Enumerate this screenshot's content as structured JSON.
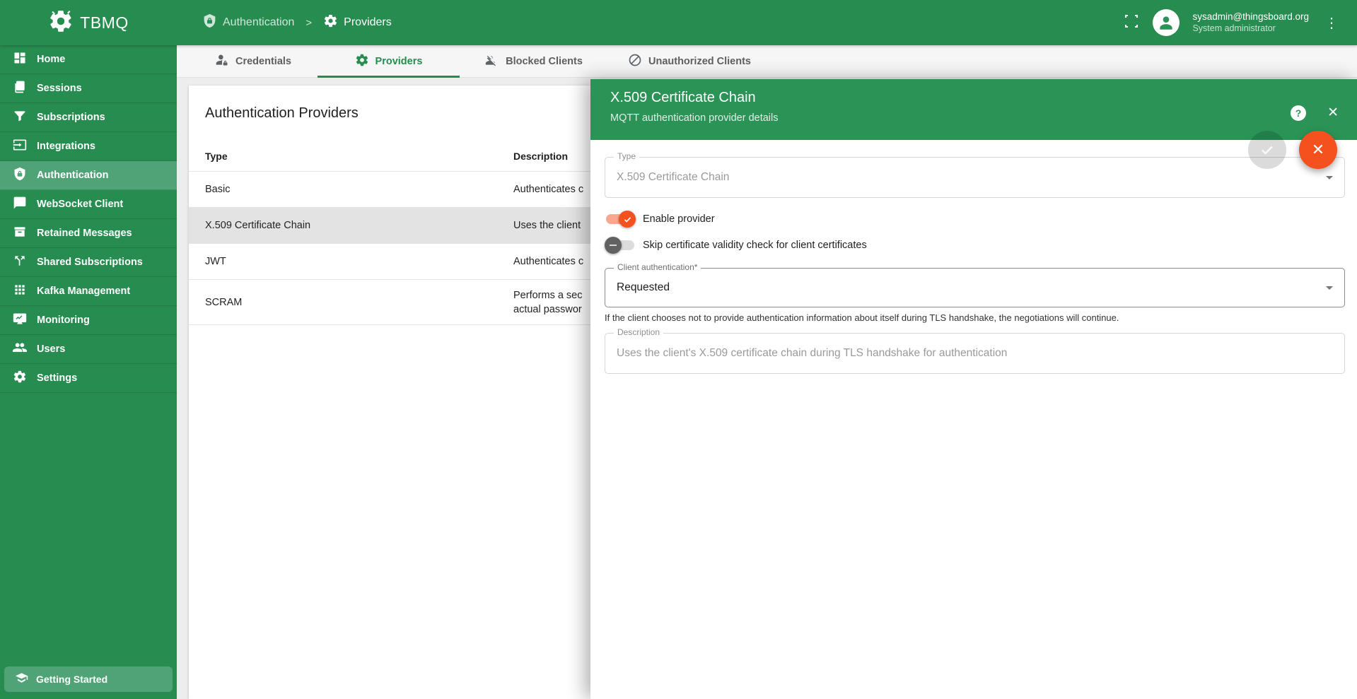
{
  "colors": {
    "primary_green": "#268C4F",
    "active_green": "#4FA376",
    "panel_green": "#2B9356",
    "deep_orange": "#F4511E",
    "selected_row": "#E3E3E3",
    "page_bg": "#EDEDED"
  },
  "icons": {
    "help": "?",
    "close": "✕",
    "more": "⋮",
    "crumb_separator": ">"
  },
  "topbar": {
    "brand": "TBMQ",
    "breadcrumb": {
      "parent": "Authentication",
      "current": "Providers"
    },
    "user": {
      "email": "sysadmin@thingsboard.org",
      "role": "System administrator"
    }
  },
  "sidebar": {
    "items": [
      {
        "label": "Home",
        "icon": "dashboard-icon"
      },
      {
        "label": "Sessions",
        "icon": "sessions-icon"
      },
      {
        "label": "Subscriptions",
        "icon": "filter-icon"
      },
      {
        "label": "Integrations",
        "icon": "integrations-icon"
      },
      {
        "label": "Authentication",
        "icon": "shield-lock-icon",
        "active": true
      },
      {
        "label": "WebSocket Client",
        "icon": "chat-icon"
      },
      {
        "label": "Retained Messages",
        "icon": "archive-icon"
      },
      {
        "label": "Shared Subscriptions",
        "icon": "split-icon"
      },
      {
        "label": "Kafka Management",
        "icon": "grid-icon"
      },
      {
        "label": "Monitoring",
        "icon": "monitor-icon"
      },
      {
        "label": "Users",
        "icon": "users-icon"
      },
      {
        "label": "Settings",
        "icon": "gear-icon"
      }
    ],
    "getting_started": "Getting Started"
  },
  "tabs": [
    {
      "label": "Credentials",
      "icon": "person-lock-icon"
    },
    {
      "label": "Providers",
      "icon": "gear-icon",
      "active": true
    },
    {
      "label": "Blocked Clients",
      "icon": "person-off-icon"
    },
    {
      "label": "Unauthorized Clients",
      "icon": "block-icon"
    }
  ],
  "main": {
    "title": "Authentication Providers",
    "table": {
      "col_type": "Type",
      "col_description": "Description",
      "rows": [
        {
          "type": "Basic",
          "desc": "Authenticates c"
        },
        {
          "type": "X.509 Certificate Chain",
          "desc": "Uses the client",
          "selected": true
        },
        {
          "type": "JWT",
          "desc": "Authenticates c"
        },
        {
          "type": "SCRAM",
          "desc": "Performs a sec",
          "desc2": "actual passwor"
        }
      ]
    }
  },
  "panel": {
    "title": "X.509 Certificate Chain",
    "subtitle": "MQTT authentication provider details",
    "type_field": {
      "label": "Type",
      "value": "X.509 Certificate Chain"
    },
    "enable_toggle": {
      "label": "Enable provider",
      "on": true
    },
    "skip_toggle": {
      "label": "Skip certificate validity check for client certificates",
      "on": false
    },
    "client_auth_field": {
      "label": "Client authentication*",
      "value": "Requested",
      "hint": "If the client chooses not to provide authentication information about itself during TLS handshake, the negotiations will continue."
    },
    "description_field": {
      "label": "Description",
      "value": "Uses the client's X.509 certificate chain during TLS handshake for authentication"
    }
  }
}
